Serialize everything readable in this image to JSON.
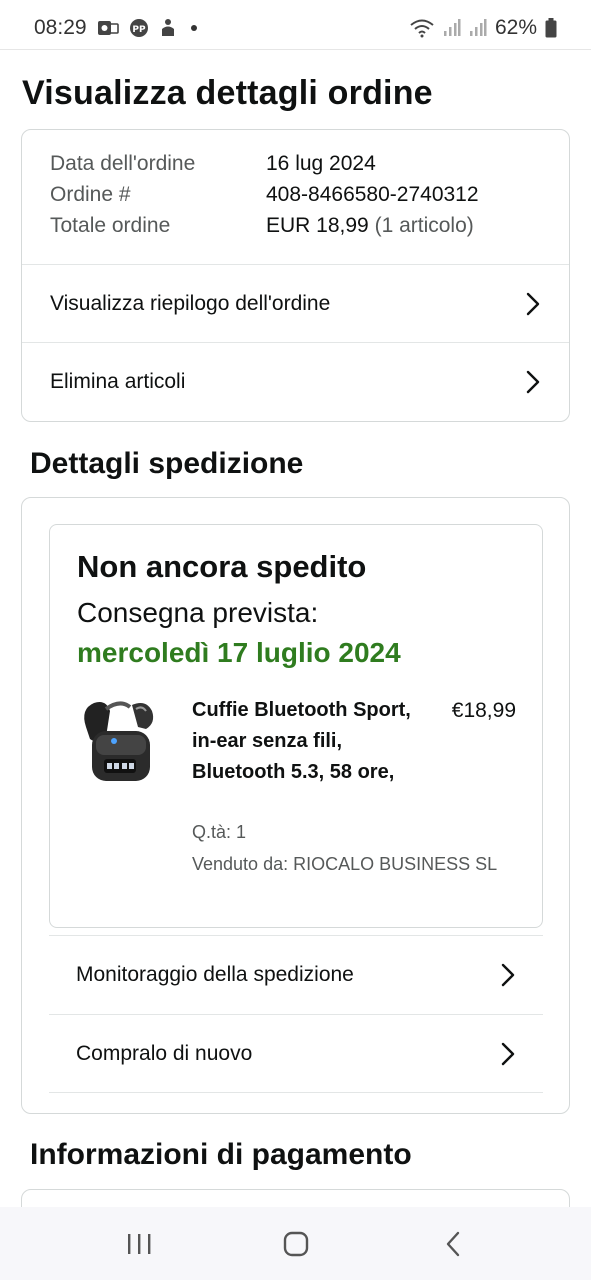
{
  "status_bar": {
    "time": "08:29",
    "battery": "62%",
    "icons": [
      "outlook-icon",
      "pp-icon",
      "person-icon",
      "notification-dot",
      "wifi-icon",
      "signal-icon",
      "signal-icon-2",
      "battery-icon"
    ]
  },
  "page": {
    "title": "Visualizza dettagli ordine"
  },
  "order_summary": {
    "rows": [
      {
        "label": "Data dell'ordine",
        "value": "16 lug 2024"
      },
      {
        "label": "Ordine #",
        "value": "408-8466580-2740312"
      },
      {
        "label": "Totale ordine",
        "value": "EUR 18,99",
        "extra": "(1 articolo)"
      }
    ],
    "links": [
      {
        "label": "Visualizza riepilogo dell'ordine"
      },
      {
        "label": "Elimina articoli"
      }
    ]
  },
  "shipping": {
    "section_title": "Dettagli spedizione",
    "status": "Non ancora spedito",
    "expected_label": "Consegna prevista:",
    "expected_date": "mercoledì 17 luglio 2024",
    "product": {
      "title": "Cuffie Bluetooth Sport, in-ear senza fili, Bluetooth 5.3, 58 ore,",
      "price": "€18,99",
      "qty": "Q.tà: 1",
      "seller": "Venduto da: RIOCALO BUSINESS SL"
    },
    "links": [
      {
        "label": "Monitoraggio della spedizione"
      },
      {
        "label": "Compralo di nuovo"
      }
    ]
  },
  "payment": {
    "section_title": "Informazioni di pagamento"
  },
  "colors": {
    "delivery_green": "#2f7c1f",
    "border": "#d5d9d9",
    "muted_text": "#565959"
  }
}
